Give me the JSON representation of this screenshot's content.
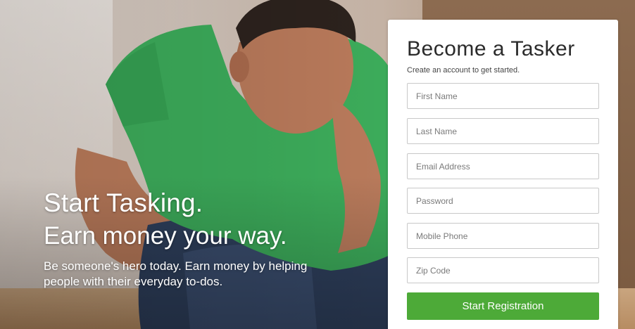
{
  "hero": {
    "headline": "Start Tasking.",
    "subheadline": "Earn money your way.",
    "body": "Be someone's hero today. Earn money by helping people with their everyday to-dos."
  },
  "signup": {
    "title": "Become a Tasker",
    "subtitle": "Create an account to get started.",
    "fields": {
      "first_name": {
        "placeholder": "First Name",
        "value": ""
      },
      "last_name": {
        "placeholder": "Last Name",
        "value": ""
      },
      "email": {
        "placeholder": "Email Address",
        "value": ""
      },
      "password": {
        "placeholder": "Password",
        "value": ""
      },
      "mobile_phone": {
        "placeholder": "Mobile Phone",
        "value": ""
      },
      "zip_code": {
        "placeholder": "Zip Code",
        "value": ""
      }
    },
    "submit_label": "Start Registration"
  },
  "colors": {
    "accent_green": "#4daa38",
    "shirt_green": "#3cab5a",
    "card_background": "#ffffff",
    "title_text": "#2b2b2b"
  }
}
